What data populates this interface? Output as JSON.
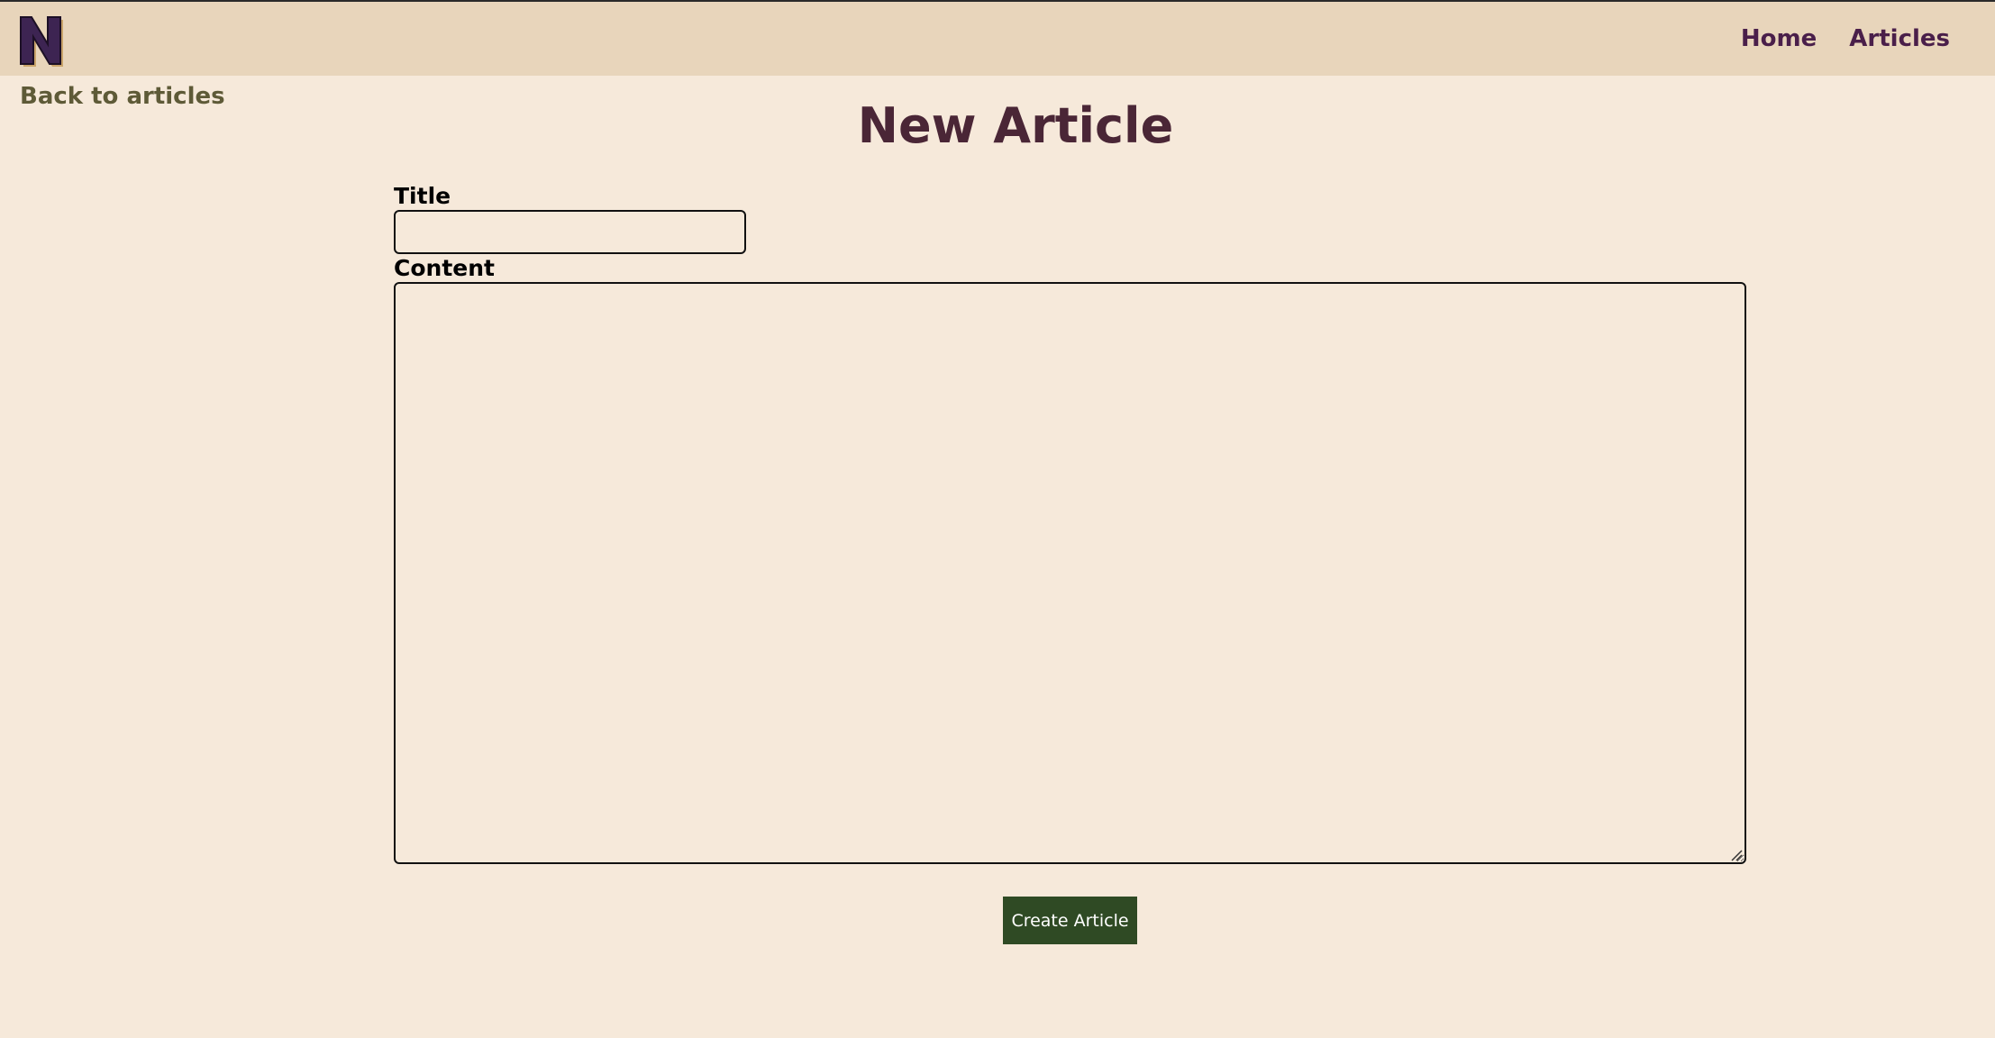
{
  "nav": {
    "logo_icon": "n-logo-icon",
    "links": [
      {
        "label": "Home"
      },
      {
        "label": "Articles"
      }
    ]
  },
  "back_link": "Back to articles",
  "page_title": "New Article",
  "form": {
    "title_label": "Title",
    "title_value": "",
    "content_label": "Content",
    "content_value": "",
    "submit_label": "Create Article"
  },
  "colors": {
    "page_background": "#f6e9da",
    "navbar_background": "#e8d5bb",
    "nav_link": "#4a1f4a",
    "title": "#4a2636",
    "back_link": "#5e5a37",
    "button": "#2f4a24",
    "logo_fill": "#3d2452",
    "logo_outline": "#c9a46a"
  }
}
